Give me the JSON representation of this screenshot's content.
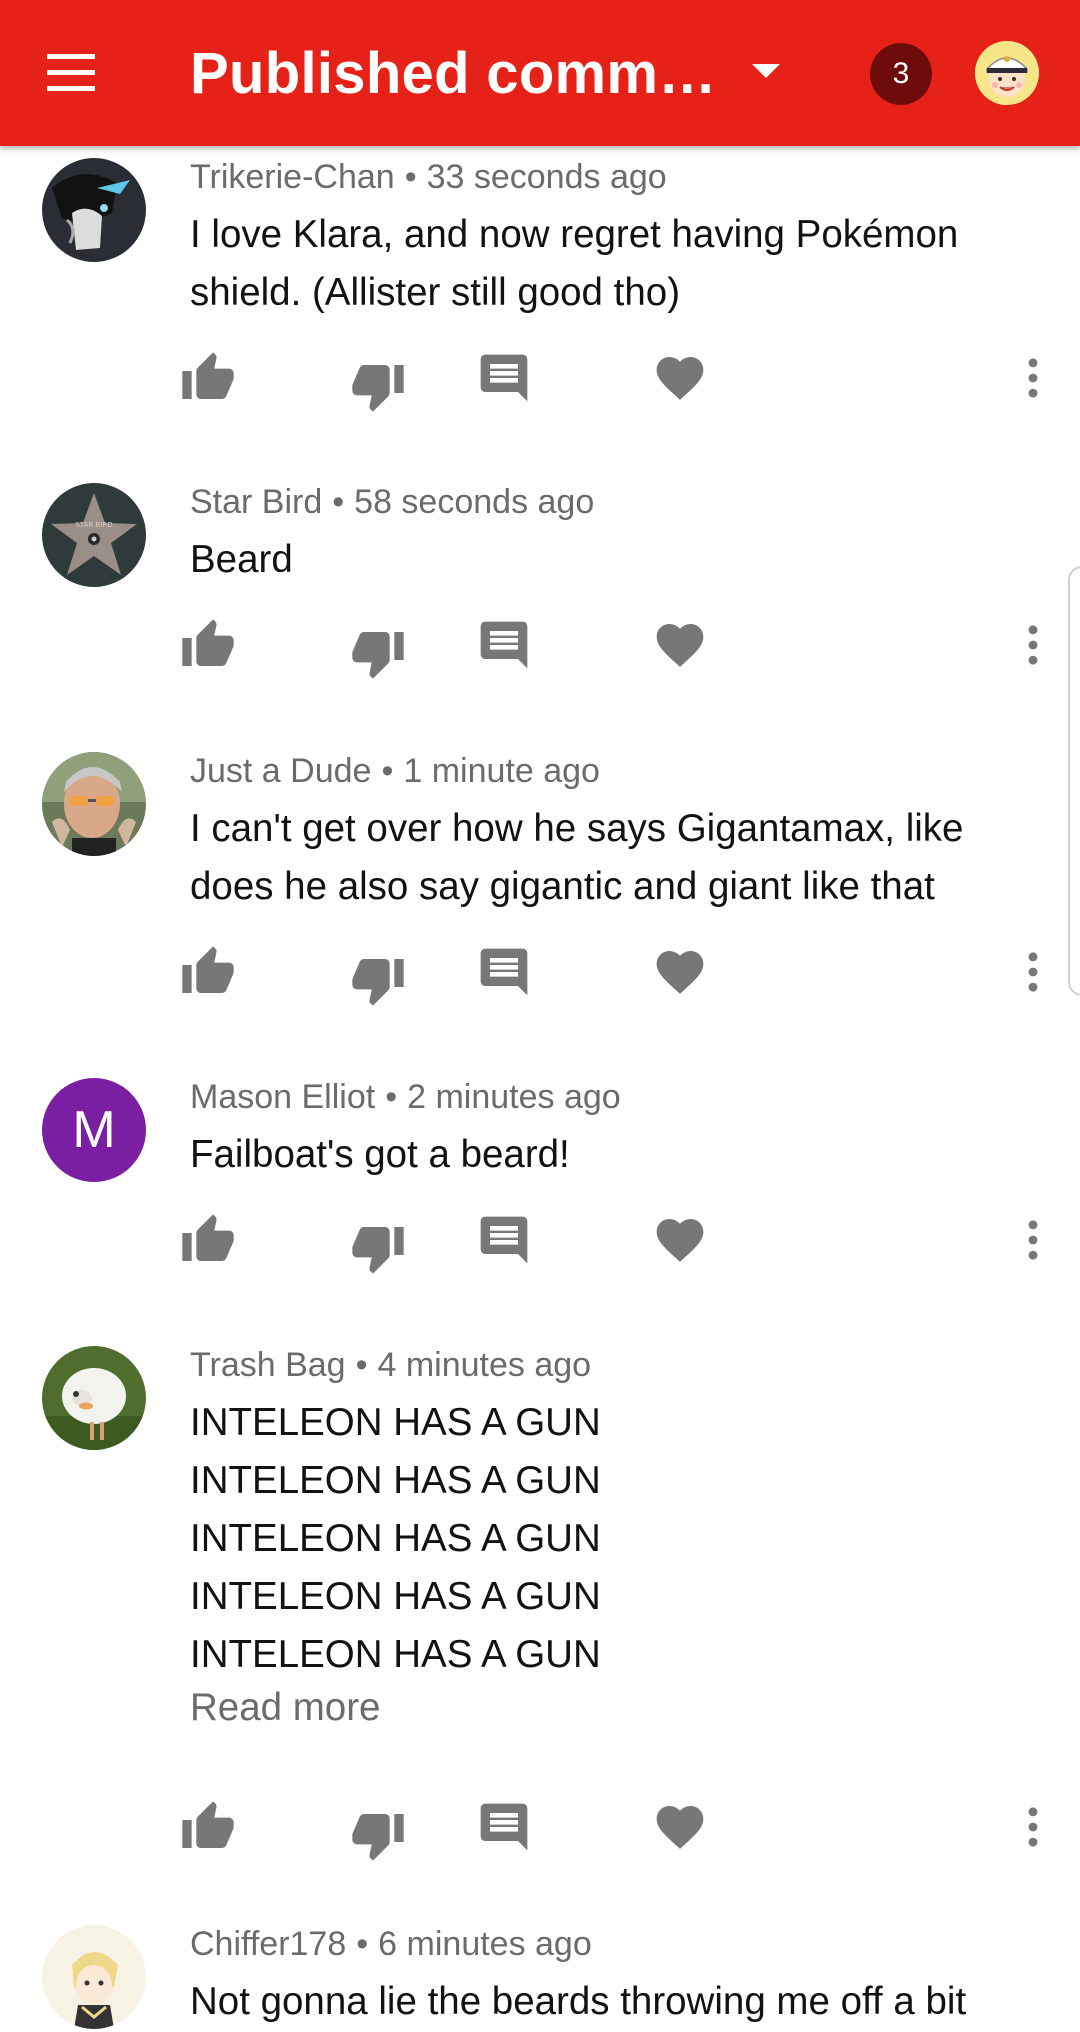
{
  "app_bar": {
    "title": "Published comm…",
    "notification_count": "3",
    "accent_color": "#e62117"
  },
  "comments": [
    {
      "author": "Trikerie-Chan",
      "time": "33 seconds ago",
      "lines": [
        "I love Klara, and now regret having Pokémon",
        "shield. (Allister still good tho)"
      ]
    },
    {
      "author": "Star Bird",
      "time": "58 seconds ago",
      "lines": [
        "Beard"
      ],
      "avatar_text": "STAR BIRD"
    },
    {
      "author": "Just a Dude",
      "time": "1 minute ago",
      "lines": [
        "I can't get over how he says Gigantamax, like",
        "does he also say gigantic and giant like that"
      ]
    },
    {
      "author": "Mason Elliot",
      "time": "2 minutes ago",
      "lines": [
        "Failboat's got a beard!"
      ],
      "avatar_letter": "M",
      "avatar_color": "#7b1fa2"
    },
    {
      "author": "Trash Bag",
      "time": "4 minutes ago",
      "lines": [
        "INTELEON HAS A GUN",
        "INTELEON HAS A GUN",
        "INTELEON HAS A GUN",
        "INTELEON HAS A GUN",
        "INTELEON HAS A GUN"
      ],
      "read_more": "Read more"
    },
    {
      "author": "Chiffer178",
      "time": "6 minutes ago",
      "lines": [
        "Not gonna lie the beards throwing me off a bit"
      ]
    }
  ],
  "separator": "•",
  "icons": {
    "menu": "hamburger-icon",
    "dropdown": "caret-down-icon",
    "like": "thumb-up-icon",
    "dislike": "thumb-down-icon",
    "reply": "comment-icon",
    "heart": "heart-icon",
    "more": "more-vert-icon"
  }
}
